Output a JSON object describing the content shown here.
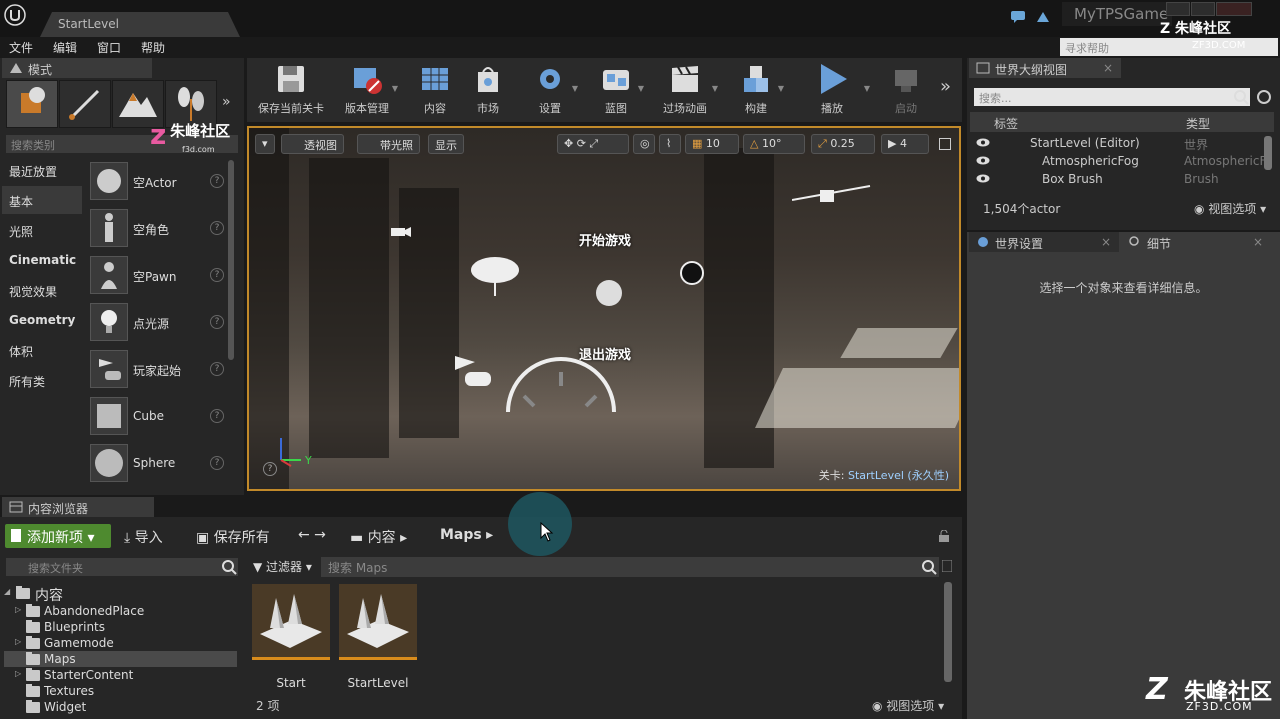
{
  "window": {
    "tab_title": "StartLevel",
    "game_name": "MyTPSGame",
    "help_search_placeholder": "寻求帮助"
  },
  "menu": [
    "文件",
    "编辑",
    "窗口",
    "帮助"
  ],
  "watermark": {
    "text_top": "朱峰社区",
    "text_small": "ZF3D.COM",
    "text_modes": "朱峰社区",
    "text_modes_small": "f3d.com",
    "text_bottom": "朱峰社区",
    "text_bottom_small": "ZF3D.COM"
  },
  "modes": {
    "tab_label": "模式",
    "search_placeholder": "搜索类别",
    "categories": [
      "最近放置",
      "基本",
      "光照",
      "Cinematic",
      "视觉效果",
      "Geometry",
      "体积",
      "所有类"
    ],
    "items": [
      "空Actor",
      "空角色",
      "空Pawn",
      "点光源",
      "玩家起始",
      "Cube",
      "Sphere"
    ]
  },
  "toolbar": {
    "buttons": [
      "保存当前关卡",
      "版本管理",
      "内容",
      "市场",
      "设置",
      "蓝图",
      "过场动画",
      "构建",
      "播放",
      "启动"
    ]
  },
  "viewport": {
    "perspective": "透视图",
    "lit": "带光照",
    "show": "显示",
    "grid_snap": "10",
    "rot_snap": "10°",
    "scale_snap": "0.25",
    "cam_speed": "4",
    "text_start": "开始游戏",
    "text_quit": "退出游戏",
    "level_prefix": "关卡:",
    "level_name": "StartLevel (永久性)",
    "axis_y": "Y"
  },
  "outliner": {
    "tab_label": "世界大纲视图",
    "search_placeholder": "搜索...",
    "col_label": "标签",
    "col_type": "类型",
    "rows": [
      {
        "name": "StartLevel (Editor)",
        "type": "世界"
      },
      {
        "name": "AtmosphericFog",
        "type": "AtmosphericF"
      },
      {
        "name": "Box Brush",
        "type": "Brush"
      }
    ],
    "count": "1,504个actor",
    "view_options": "视图选项"
  },
  "details": {
    "tab_world": "世界设置",
    "tab_details": "细节",
    "empty_msg": "选择一个对象来查看详细信息。"
  },
  "content_browser": {
    "tab_label": "内容浏览器",
    "add_new": "添加新项",
    "import": "导入",
    "save_all": "保存所有",
    "crumbs": [
      "内容",
      "Maps"
    ],
    "folder_search_placeholder": "搜索文件夹",
    "filters": "过滤器",
    "search_placeholder": "搜索 Maps",
    "root": "内容",
    "folders": [
      "AbandonedPlace",
      "Blueprints",
      "Gamemode",
      "Maps",
      "StarterContent",
      "Textures",
      "Widget"
    ],
    "assets": [
      "Start",
      "StartLevel"
    ],
    "count": "2 项",
    "view_options": "视图选项"
  },
  "colors": {
    "accent_orange": "#c28a2a",
    "add_new_green": "#4e8a2f",
    "asset_underline": "#d98c1c"
  }
}
